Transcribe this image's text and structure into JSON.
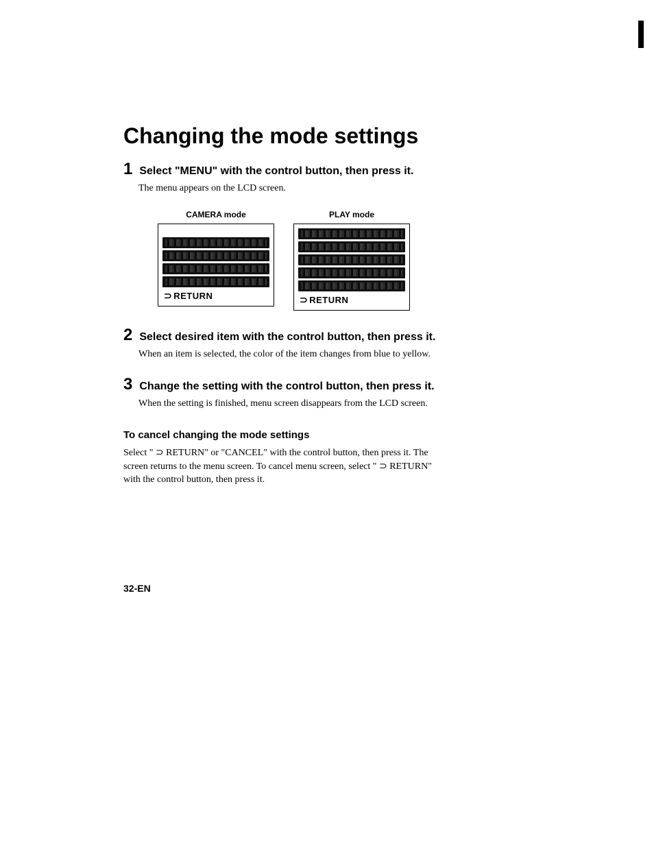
{
  "title": "Changing the mode settings",
  "steps": [
    {
      "num": "1",
      "title": "Select \"MENU\" with the control button, then press it.",
      "body": "The menu appears on the LCD screen."
    },
    {
      "num": "2",
      "title": "Select desired item with the control button, then press it.",
      "body": "When an item is selected, the color of the item changes from blue to yellow."
    },
    {
      "num": "3",
      "title": "Change the setting with the control button, then press it.",
      "body": "When the setting is finished, menu screen disappears from the LCD screen."
    }
  ],
  "screens": {
    "camera": {
      "label": "CAMERA mode",
      "return": "RETURN"
    },
    "play": {
      "label": "PLAY mode",
      "return": "RETURN"
    }
  },
  "cancel": {
    "title": "To cancel changing the mode settings",
    "body": "Select \" ⊃ RETURN\" or \"CANCEL\" with the control button, then press it. The screen returns to the menu screen. To cancel menu screen, select \" ⊃ RETURN\" with the control button, then press it."
  },
  "pageNum": "32-EN"
}
